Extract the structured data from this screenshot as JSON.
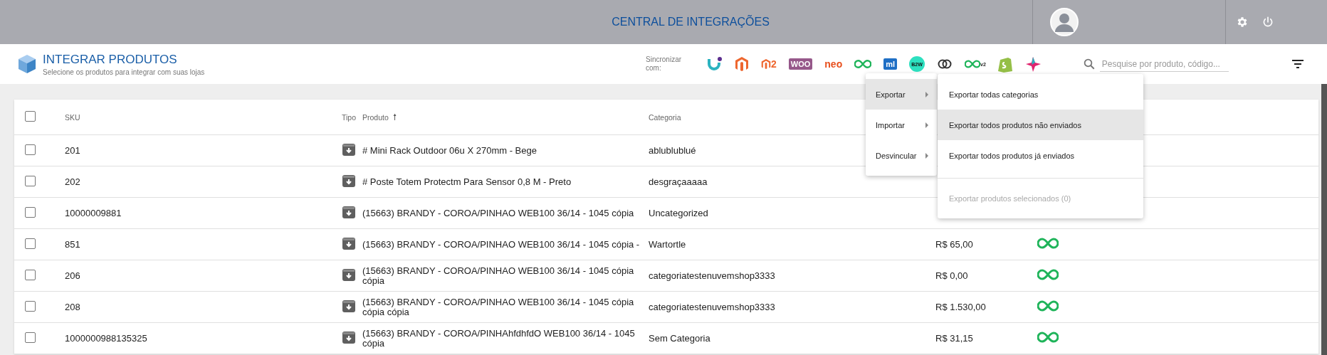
{
  "topbar": {
    "title": "CENTRAL DE INTEGRAÇÕES"
  },
  "header": {
    "title": "INTEGRAR PRODUTOS",
    "subtitle": "Selecione os produtos para integrar com suas lojas",
    "sync_label": "Sincronizar com:",
    "integrations": [
      {
        "kind": "u",
        "color": "#2bb3c0"
      },
      {
        "kind": "magento",
        "color": "#ee672f"
      },
      {
        "kind": "magento2",
        "label": "2",
        "color": "#ee672f"
      },
      {
        "kind": "boxed",
        "label": "WOO",
        "color": "#96588a"
      },
      {
        "kind": "word",
        "label": "neo",
        "color": "#e8501e"
      },
      {
        "kind": "infinity",
        "color": "#1fb45a"
      },
      {
        "kind": "boxed",
        "label": "ml",
        "color": "#1f6fc5"
      },
      {
        "kind": "circle",
        "label": "B2W",
        "color": "#2de0c0"
      },
      {
        "kind": "rings",
        "color": "#333333"
      },
      {
        "kind": "infinity",
        "label": "v2",
        "color": "#1fb45a"
      },
      {
        "kind": "bag",
        "color": "#95bf47"
      },
      {
        "kind": "star",
        "color": "#e0246e"
      }
    ],
    "search": {
      "placeholder": "Pesquise por produto, código..."
    }
  },
  "table": {
    "select_all": {
      "checked": false
    },
    "columns": [
      "SKU",
      "Tipo",
      "Produto",
      "Categoria"
    ],
    "sort_arrow": "🠕",
    "rows": [
      {
        "checked": false,
        "sku": "201",
        "product": "# Mini Rack Outdoor 06u X 270mm - Bege",
        "category": "ablublublué"
      },
      {
        "checked": false,
        "sku": "202",
        "product": "# Poste Totem Protectm Para Sensor 0,8 M - Preto",
        "category": "desgraçaaaaa"
      },
      {
        "checked": false,
        "sku": "10000009881",
        "product": "(15663) BRANDY - COROA/PINHAO WEB100 36/14 - 1045 cópia",
        "category": "Uncategorized"
      },
      {
        "checked": false,
        "sku": "851",
        "product": "(15663) BRANDY - COROA/PINHAO WEB100 36/14 - 1045 cópia -",
        "category": "Wartortle",
        "price": "R$ 65,00",
        "synced": true
      },
      {
        "checked": false,
        "sku": "206",
        "product": "(15663) BRANDY - COROA/PINHAO WEB100 36/14 - 1045 cópia cópia",
        "category": "categoriatestenuvemshop3333",
        "price": "R$ 0,00",
        "synced": true
      },
      {
        "checked": false,
        "sku": "208",
        "product": "(15663) BRANDY - COROA/PINHAO WEB100 36/14 - 1045 cópia cópia cópia",
        "category": "categoriatestenuvemshop3333",
        "price": "R$ 1.530,00",
        "synced": true
      },
      {
        "checked": false,
        "sku": "1000000988135325",
        "product": "(15663) BRANDY - COROA/PINHAhfdhfdO WEB100 36/14 - 1045 cópia",
        "category": "Sem Categoria",
        "price": "R$ 31,15",
        "synced": true
      }
    ]
  },
  "menu": {
    "items": [
      {
        "label": "Exportar",
        "selected": true
      },
      {
        "label": "Importar",
        "selected": false
      },
      {
        "label": "Desvincular",
        "selected": false
      }
    ],
    "submenu": [
      {
        "label": "Exportar todas categorias",
        "hovered": false,
        "disabled": false
      },
      {
        "label": "Exportar todos produtos não enviados",
        "hovered": true,
        "disabled": false
      },
      {
        "label": "Exportar todos produtos já enviados",
        "hovered": false,
        "disabled": false
      },
      {
        "label": "Exportar produtos selecionados (0)",
        "hovered": false,
        "disabled": true
      }
    ]
  }
}
